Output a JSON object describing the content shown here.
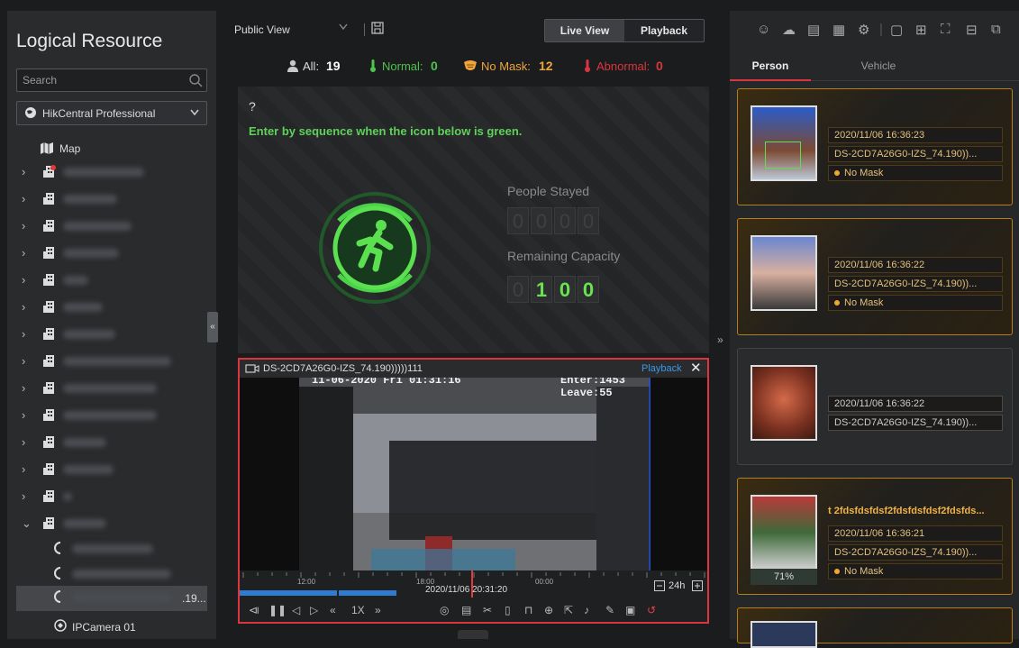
{
  "left_panel": {
    "title": "Logical Resource",
    "search_placeholder": "Search",
    "site_selector": "HikCentral Professional",
    "map_label": "Map",
    "camera_partial_suffix": ".19...",
    "camera_last": "IPCamera 01"
  },
  "toolbar": {
    "view_name": "Public View",
    "live_view": "Live View",
    "playback": "Playback"
  },
  "stats": {
    "all_label": "All:",
    "all_value": "19",
    "normal_label": "Normal:",
    "normal_value": "0",
    "nomask_label": "No Mask:",
    "nomask_value": "12",
    "abnormal_label": "Abnormal:",
    "abnormal_value": "0"
  },
  "top_video": {
    "question_mark": "?",
    "instruction": "Enter by sequence when the icon below is green.",
    "people_stayed_label": "People Stayed",
    "people_stayed_digits": [
      "0",
      "0",
      "0",
      "0"
    ],
    "remaining_label": "Remaining Capacity",
    "remaining_digits": [
      "0",
      "1",
      "0",
      "0"
    ]
  },
  "player": {
    "camera_title": "DS-2CD7A26G0-IZS_74.190)))))111",
    "playback_link": "Playback",
    "close_glyph": "✕",
    "osd_datetime": "11-06-2020 Fri 01:31:16",
    "osd_enter": "Enter:1453",
    "osd_leave": "Leave:55",
    "timeline_ticks": [
      "12:00",
      "18:00",
      "00:00"
    ],
    "timeline_timestamp": "2020/11/06 20:31:20",
    "timeline_range": "24h",
    "speed": "1X"
  },
  "right_panel": {
    "tabs": [
      "Person",
      "Vehicle"
    ],
    "cards": [
      {
        "time": "2020/11/06 16:36:23",
        "device": "DS-2CD7A26G0-IZS_74.190))...",
        "status": "No Mask"
      },
      {
        "time": "2020/11/06 16:36:22",
        "device": "DS-2CD7A26G0-IZS_74.190))...",
        "status": "No Mask"
      },
      {
        "time": "2020/11/06 16:36:22",
        "device": "DS-2CD7A26G0-IZS_74.190))..."
      },
      {
        "header": "t 2fdsfdsfdsf2fdsfdsfdsf2fdsfds...",
        "time": "2020/11/06 16:36:21",
        "device": "DS-2CD7A26G0-IZS_74.190))...",
        "status": "No Mask",
        "similarity": "71%"
      }
    ]
  },
  "colors": {
    "accent_red": "#d9363e",
    "green": "#5fd25a",
    "amber": "#f0b347",
    "playback_blue": "#3d97e8"
  }
}
